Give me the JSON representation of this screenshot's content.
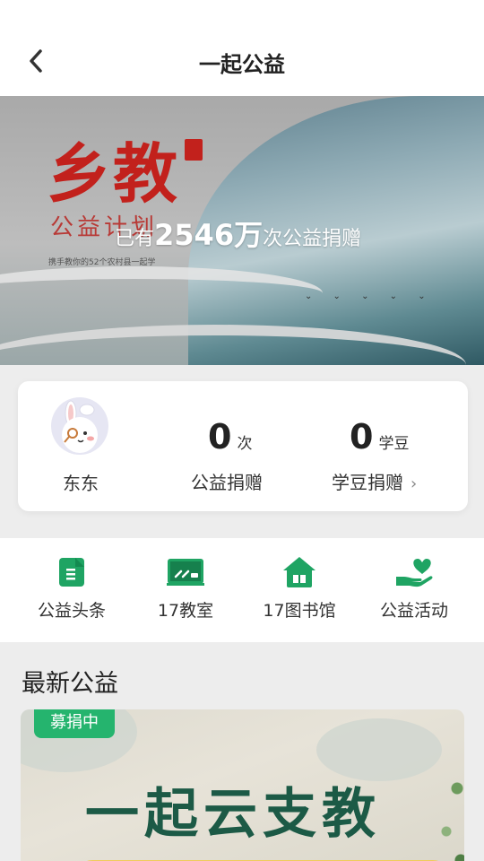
{
  "header": {
    "title": "一起公益",
    "back_icon": "chevron-left-icon"
  },
  "banner": {
    "calligraphy": "乡教",
    "calligraphy_sub": "公益计划",
    "fine_print": "携手教你的52个农村县一起学",
    "prefix": "已有",
    "count": "2546万",
    "suffix": "次公益捐赠"
  },
  "profile": {
    "nickname": "东东",
    "donations": {
      "value": "0",
      "unit": "次",
      "label": "公益捐赠"
    },
    "beans": {
      "value": "0",
      "unit": "学豆",
      "label": "学豆捐赠"
    }
  },
  "shortcuts": [
    {
      "label": "公益头条",
      "icon": "document-icon"
    },
    {
      "label": "17教室",
      "icon": "blackboard-icon"
    },
    {
      "label": "17图书馆",
      "icon": "library-house-icon"
    },
    {
      "label": "公益活动",
      "icon": "heart-hand-icon"
    }
  ],
  "latest": {
    "title": "最新公益",
    "project": {
      "status": "募捐中",
      "name": "一起云支教"
    }
  },
  "colors": {
    "accent": "#25b46e",
    "icon_green": "#1fa463",
    "calligraphy_red": "#c2211c"
  }
}
